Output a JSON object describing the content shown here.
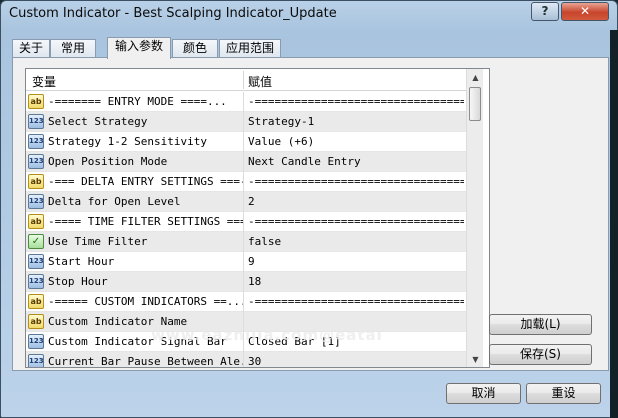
{
  "window": {
    "title": "Custom Indicator - Best Scalping Indicator_Update",
    "help_label": "?",
    "close_label": "✕"
  },
  "tabs": [
    {
      "label": "关于",
      "active": false
    },
    {
      "label": "常用",
      "active": false
    },
    {
      "label": "输入参数",
      "active": true
    },
    {
      "label": "颜色",
      "active": false
    },
    {
      "label": "应用范围",
      "active": false
    }
  ],
  "grid": {
    "col_variable": "变量",
    "col_value": "赋值",
    "rows": [
      {
        "icon": "ab",
        "name": "-=======   ENTRY  MODE   ====...",
        "value": "-================================..."
      },
      {
        "icon": "123",
        "name": "Select Strategy",
        "value": "Strategy-1"
      },
      {
        "icon": "123",
        "name": "Strategy 1-2 Sensitivity",
        "value": "Value (+6)"
      },
      {
        "icon": "123",
        "name": "Open Position Mode",
        "value": "Next Candle Entry"
      },
      {
        "icon": "ab",
        "name": "-=== DELTA ENTRY SETTINGS ===-",
        "value": "-================================..."
      },
      {
        "icon": "123",
        "name": "Delta for Open Level",
        "value": "2"
      },
      {
        "icon": "ab",
        "name": "-==== TIME FILTER SETTINGS ====-",
        "value": "-================================..."
      },
      {
        "icon": "bool",
        "name": "Use Time Filter",
        "value": "false"
      },
      {
        "icon": "123",
        "name": "Start Hour",
        "value": "9"
      },
      {
        "icon": "123",
        "name": "Stop Hour",
        "value": "18"
      },
      {
        "icon": "ab",
        "name": "-=====  CUSTOM INDICATORS  ==...",
        "value": "-================================..."
      },
      {
        "icon": "ab",
        "name": "Custom Indicator Name",
        "value": ""
      },
      {
        "icon": "123",
        "name": "Custom Indicator Signal Bar",
        "value": "Closed Bar [1]"
      },
      {
        "icon": "123",
        "name": "Current Bar Pause Between Ale...",
        "value": "30"
      }
    ]
  },
  "buttons": {
    "load": "加载(L)",
    "save": "保存(S)",
    "cancel": "取消",
    "reset": "重设"
  },
  "watermark": "www.eazhijia.com@eatai"
}
